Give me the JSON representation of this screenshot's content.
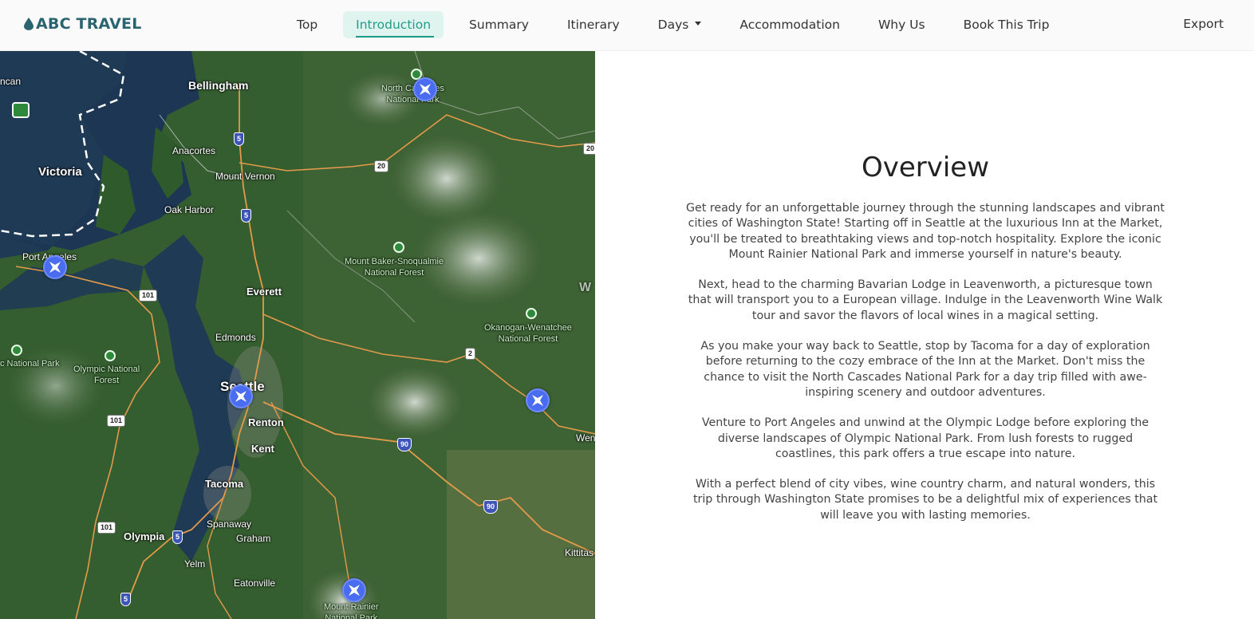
{
  "brand": {
    "name": "ABC TRAVEL",
    "color": "#2a6470"
  },
  "nav": {
    "items": [
      {
        "label": "Top"
      },
      {
        "label": "Introduction",
        "active": true
      },
      {
        "label": "Summary"
      },
      {
        "label": "Itinerary"
      },
      {
        "label": "Days",
        "dropdown": true
      },
      {
        "label": "Accommodation"
      },
      {
        "label": "Why Us"
      },
      {
        "label": "Book This Trip"
      }
    ],
    "export_label": "Export",
    "active_color": "#1f9d88"
  },
  "map": {
    "labels": {
      "bellingham": "Bellingham",
      "anacortes": "Anacortes",
      "victoria": "Victoria",
      "mount_vernon": "Mount Vernon",
      "oak_harbor": "Oak Harbor",
      "port_angeles": "Port Angeles",
      "everett": "Everett",
      "edmonds": "Edmonds",
      "seattle": "Seattle",
      "renton": "Renton",
      "kent": "Kent",
      "tacoma": "Tacoma",
      "spanaway": "Spanaway",
      "graham": "Graham",
      "olympia": "Olympia",
      "yelm": "Yelm",
      "eatonville": "Eatonville",
      "kittitas": "Kittitas",
      "north_cascades": "North Cascades\nNational Park",
      "mbs_forest": "Mount Baker-Snoqualmie\nNational Forest",
      "okanogan_forest": "Okanogan-Wenatchee\nNational Forest",
      "olympic_forest": "Olympic National\nForest",
      "olympic_park": "c National Park",
      "mount_rainier": "Mount Rainier\nNational Park",
      "can": "ncan",
      "wen": "Wen",
      "w": "W"
    },
    "shields": {
      "i5_a": "5",
      "i5_b": "5",
      "i5_c": "5",
      "i5_d": "5",
      "us101_a": "101",
      "us101_b": "101",
      "us101_c": "101",
      "us2": "2",
      "i90_a": "90",
      "i90_b": "90",
      "sr20_a": "20",
      "sr20_b": "20"
    },
    "marker_color": "#4a6cf0"
  },
  "overview": {
    "title": "Overview",
    "paragraphs": [
      "Get ready for an unforgettable journey through the stunning landscapes and vibrant cities of Washington State! Starting off in Seattle at the luxurious Inn at the Market, you'll be treated to breathtaking views and top-notch hospitality. Explore the iconic Mount Rainier National Park and immerse yourself in nature's beauty.",
      "Next, head to the charming Bavarian Lodge in Leavenworth, a picturesque town that will transport you to a European village. Indulge in the Leavenworth Wine Walk tour and savor the flavors of local wines in a magical setting.",
      "As you make your way back to Seattle, stop by Tacoma for a day of exploration before returning to the cozy embrace of the Inn at the Market. Don't miss the chance to visit the North Cascades National Park for a day trip filled with awe-inspiring scenery and outdoor adventures.",
      "Venture to Port Angeles and unwind at the Olympic Lodge before exploring the diverse landscapes of Olympic National Park. From lush forests to rugged coastlines, this park offers a true escape into nature.",
      "With a perfect blend of city vibes, wine country charm, and natural wonders, this trip through Washington State promises to be a delightful mix of experiences that will leave you with lasting memories."
    ]
  }
}
